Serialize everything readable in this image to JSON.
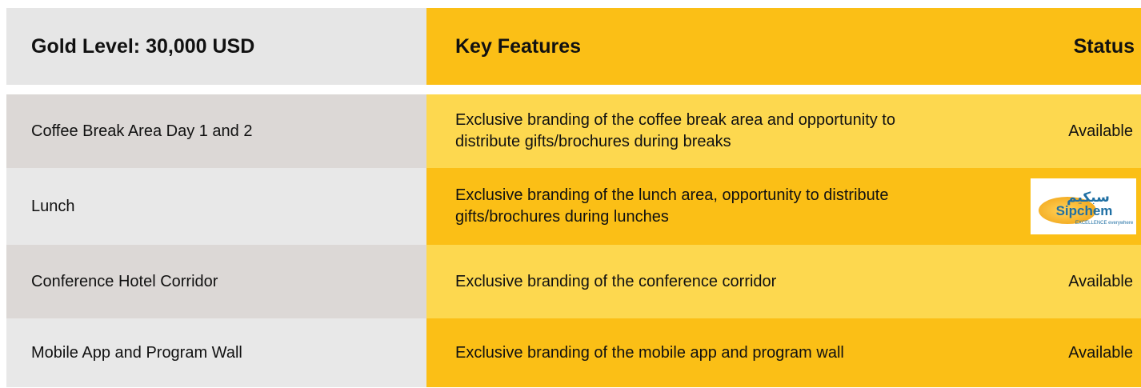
{
  "header": {
    "level": "Gold Level: 30,000 USD",
    "features": "Key Features",
    "status": "Status"
  },
  "rows": [
    {
      "item": "Coffee Break Area Day 1 and 2",
      "feature": "Exclusive branding of the coffee break area and opportunity to distribute gifts/brochures during breaks",
      "status": "Available"
    },
    {
      "item": "Lunch",
      "feature": "Exclusive branding of the lunch area, opportunity to distribute gifts/brochures during lunches",
      "logo": {
        "arabic": "سبكيم",
        "name": "Sipchem",
        "tagline": "EXCELLENCE everywhere"
      }
    },
    {
      "item": "Conference Hotel Corridor",
      "feature": "Exclusive branding of the conference corridor",
      "status": "Available"
    },
    {
      "item": "Mobile App and Program Wall",
      "feature": "Exclusive branding of the mobile app and program wall",
      "status": "Available"
    }
  ],
  "colors": {
    "gold": "#fbbf16",
    "light_gold": "#fdd84f",
    "grey": "#e6e6e6",
    "grey_alt": "#dcd8d6",
    "logo_blue": "#1f6fa3",
    "logo_orange": "#f2a71b"
  }
}
